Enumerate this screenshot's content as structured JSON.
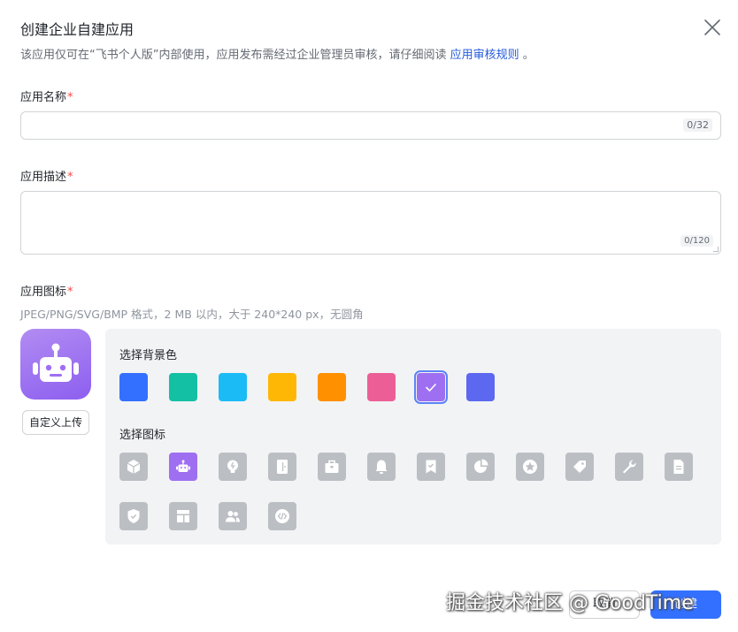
{
  "dialog": {
    "title": "创建企业自建应用",
    "subtitle_prefix": "该应用仅可在“飞书个人版”内部使用，应用发布需经过企业管理员审核，请仔细阅读",
    "subtitle_link": "应用审核规则",
    "subtitle_suffix": "。",
    "close_icon": "close-icon"
  },
  "fields": {
    "name": {
      "label": "应用名称",
      "required_mark": "*",
      "value": "",
      "counter": "0/32"
    },
    "description": {
      "label": "应用描述",
      "required_mark": "*",
      "value": "",
      "counter": "0/120"
    },
    "icon": {
      "label": "应用图标",
      "required_mark": "*",
      "hint": "JPEG/PNG/SVG/BMP 格式，2 MB 以内，大于 240*240 px，无圆角",
      "upload_label": "自定义上传"
    }
  },
  "picker": {
    "bg_title": "选择背景色",
    "icon_title": "选择图标",
    "colors": [
      "#3370ff",
      "#14c0a4",
      "#1bbbf6",
      "#ffb705",
      "#ff9000",
      "#ec5f96",
      "#9f6ff1",
      "#5b68ef"
    ],
    "selected_color_index": 6,
    "icons": [
      "cube-icon",
      "robot-icon",
      "lightbulb-icon",
      "door-icon",
      "toolbox-icon",
      "bell-icon",
      "bookmark-check-icon",
      "pie-chart-icon",
      "star-badge-icon",
      "tag-icon",
      "wrench-icon",
      "document-icon",
      "shield-check-icon",
      "layout-icon",
      "users-icon",
      "code-icon"
    ],
    "selected_icon_index": 1
  },
  "footer": {
    "cancel_label": "取消",
    "create_label": "创建"
  },
  "watermark": "掘金技术社区 @ GoodTime",
  "colors": {
    "primary": "#3370ff",
    "required": "#f54a45",
    "link": "#245bdb",
    "tile_grey": "#bbbfc4",
    "preview_purple": "#9f6ff1"
  }
}
